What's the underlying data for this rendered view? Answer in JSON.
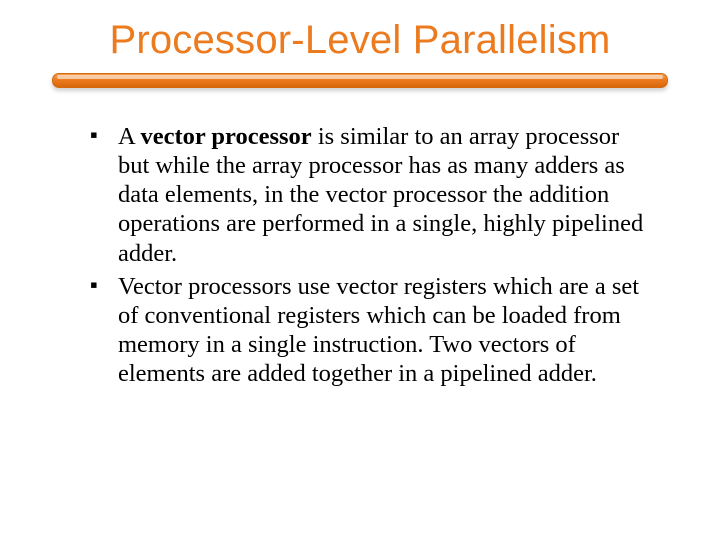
{
  "title": "Processor-Level Parallelism",
  "bullets": [
    {
      "prefix": "A ",
      "bold": "vector processor",
      "rest": " is similar to an array processor but while the array processor has as many adders as data elements, in the vector processor the addition operations are performed in a single, highly pipelined adder."
    },
    {
      "prefix": "",
      "bold": "",
      "rest": "Vector processors use vector registers which are a set of conventional registers which can be loaded from memory in a single instruction. Two vectors of elements are added together in a pipelined adder."
    }
  ]
}
